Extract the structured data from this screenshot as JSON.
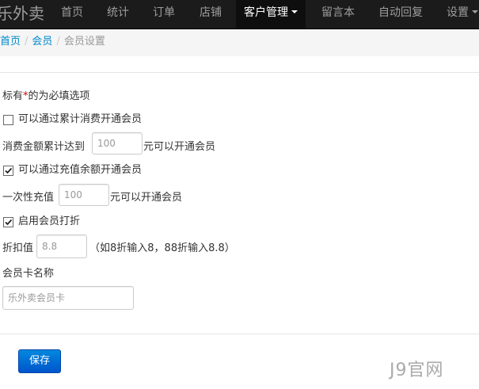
{
  "navbar": {
    "brand": "乐外卖",
    "items": [
      {
        "label": "首页"
      },
      {
        "label": "统计"
      },
      {
        "label": "订单"
      },
      {
        "label": "店铺"
      },
      {
        "label": "客户管理",
        "active": true
      },
      {
        "label": "留言本"
      },
      {
        "label": "自动回复"
      },
      {
        "label": "设置"
      }
    ]
  },
  "breadcrumb": {
    "items": [
      "首页",
      "会员",
      "会员设置"
    ],
    "divider": "/"
  },
  "form": {
    "required_note": {
      "prefix": "标有",
      "mark": "*",
      "suffix": "的为必填选项"
    },
    "options": {
      "consume": {
        "label": "可以通过累计消费开通会员",
        "checked": false,
        "prefix": "消费金额累计达到",
        "placeholder": "100",
        "suffix": "元可以开通会员"
      },
      "recharge": {
        "label": "可以通过充值余额开通会员",
        "checked": true,
        "prefix": "一次性充值",
        "placeholder": "100",
        "suffix": "元可以开通会员"
      },
      "discount": {
        "label": "启用会员打折",
        "checked": true,
        "prefix": "折扣值",
        "placeholder": "8.8",
        "hint": "（如8折输入8，88折输入8.8）"
      }
    },
    "card_name": {
      "label": "会员卡名称",
      "placeholder": "乐外卖会员卡"
    },
    "save_label": "保存"
  },
  "watermark": "J9官网",
  "colors": {
    "navbar_bg": "#1b1b1b",
    "link": "#0088cc",
    "primary_button": "#0066cc",
    "required_mark": "#cc0000"
  },
  "icons": {
    "caret": "caret-down-icon",
    "check": "checkmark-icon"
  }
}
